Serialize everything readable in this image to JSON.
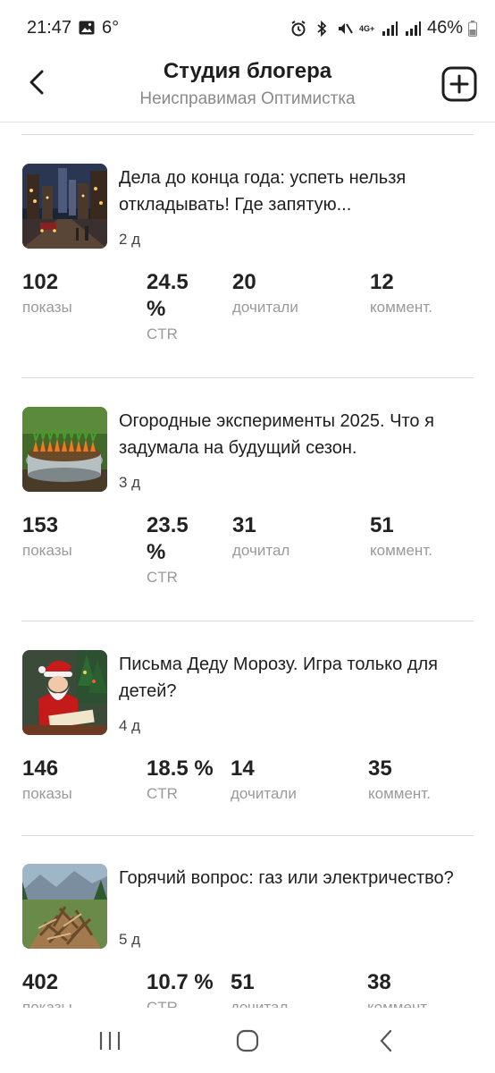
{
  "status_bar": {
    "time": "21:47",
    "temperature": "6°",
    "network": "4G+",
    "battery": "46%"
  },
  "header": {
    "title": "Студия блогера",
    "subtitle": "Неисправимая Оптимистка"
  },
  "posts": [
    {
      "title": "Дела до конца года: успеть нельзя откладывать! Где запятую...",
      "age": "2 д",
      "views_value": "102",
      "views_label": "показы",
      "ctr_value": "24.5 %",
      "ctr_label": "CTR",
      "reads_value": "20",
      "reads_label": "дочитали",
      "comments_value": "12",
      "comments_label": "коммент."
    },
    {
      "title": "Огородные эксперименты 2025. Что я задумала на будущий сезон.",
      "age": "3 д",
      "views_value": "153",
      "views_label": "показы",
      "ctr_value": "23.5 %",
      "ctr_label": "CTR",
      "reads_value": "31",
      "reads_label": "дочитал",
      "comments_value": "51",
      "comments_label": "коммент."
    },
    {
      "title": "Письма Деду Морозу. Игра только для детей?",
      "age": "4 д",
      "views_value": "146",
      "views_label": "показы",
      "ctr_value": "18.5 %",
      "ctr_label": "CTR",
      "reads_value": "14",
      "reads_label": "дочитали",
      "comments_value": "35",
      "comments_label": "коммент."
    },
    {
      "title": "Горячий вопрос: газ или электричество?",
      "age": "5 д",
      "views_value": "402",
      "views_label": "показы",
      "ctr_value": "10.7 %",
      "ctr_label": "CTR",
      "reads_value": "51",
      "reads_label": "дочитал",
      "comments_value": "38",
      "comments_label": "коммент."
    }
  ]
}
